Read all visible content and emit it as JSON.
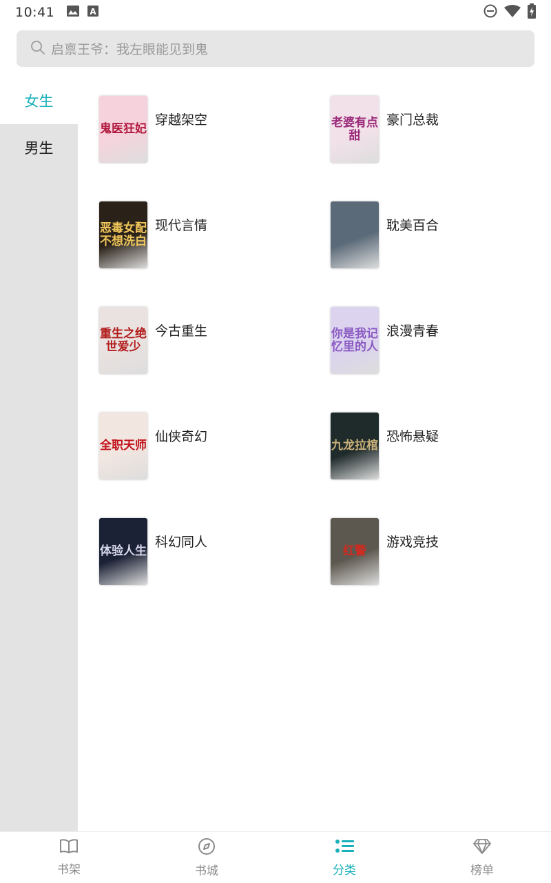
{
  "status_bar": {
    "time": "10:41",
    "left_icons": [
      "image-icon",
      "font-a-icon"
    ],
    "right_icons": [
      "do-not-disturb-icon",
      "wifi-icon",
      "battery-charging-icon"
    ]
  },
  "search": {
    "icon": "search-icon",
    "placeholder": "启禀王爷：我左眼能见到鬼"
  },
  "sidebar": {
    "items": [
      {
        "label": "女生",
        "active": true
      },
      {
        "label": "男生",
        "active": false
      }
    ]
  },
  "categories": [
    {
      "label": "穿越架空",
      "cover_text": "鬼医狂妃",
      "cover_bg": "#f6d3dc",
      "cover_fg": "#b0183e"
    },
    {
      "label": "豪门总裁",
      "cover_text": "老婆有点甜",
      "cover_bg": "#f3e1ea",
      "cover_fg": "#9b2a7a"
    },
    {
      "label": "现代言情",
      "cover_text": "恶毒女配不想洗白",
      "cover_bg": "#2a2219",
      "cover_fg": "#f1c75a"
    },
    {
      "label": "耽美百合",
      "cover_text": "",
      "cover_bg": "#5b6a78",
      "cover_fg": "#ffffff"
    },
    {
      "label": "今古重生",
      "cover_text": "重生之绝世爱少",
      "cover_bg": "#e9e2e0",
      "cover_fg": "#b21b1b"
    },
    {
      "label": "浪漫青春",
      "cover_text": "你是我记忆里的人",
      "cover_bg": "#dcd3ef",
      "cover_fg": "#8a5ac2"
    },
    {
      "label": "仙侠奇幻",
      "cover_text": "全职天师",
      "cover_bg": "#f2e6e1",
      "cover_fg": "#c2121b"
    },
    {
      "label": "恐怖悬疑",
      "cover_text": "九龙拉棺",
      "cover_bg": "#1f2a2b",
      "cover_fg": "#c8b07a"
    },
    {
      "label": "科幻同人",
      "cover_text": "体验人生",
      "cover_bg": "#1c2236",
      "cover_fg": "#d6d9ea"
    },
    {
      "label": "游戏竞技",
      "cover_text": "红警",
      "cover_bg": "#5d584f",
      "cover_fg": "#cf2b20"
    }
  ],
  "bottom_nav": [
    {
      "label": "书架",
      "icon": "book-open-icon",
      "active": false
    },
    {
      "label": "书城",
      "icon": "compass-icon",
      "active": false
    },
    {
      "label": "分类",
      "icon": "list-icon",
      "active": true
    },
    {
      "label": "榜单",
      "icon": "diamond-icon",
      "active": false
    }
  ],
  "colors": {
    "accent": "#1ab0bb",
    "sidebar_bg": "#e3e3e3",
    "search_bg": "#e6e6e6"
  }
}
